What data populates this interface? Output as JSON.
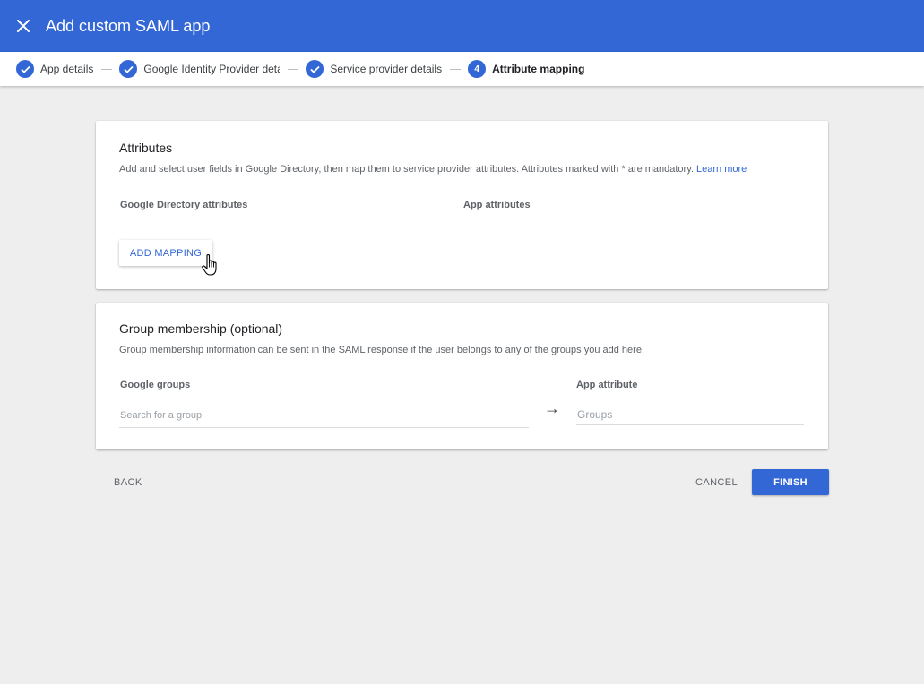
{
  "header": {
    "title": "Add custom SAML app",
    "close_icon": "close-icon"
  },
  "stepper": {
    "steps": [
      {
        "label": "App details",
        "status": "complete"
      },
      {
        "label": "Google Identity Provider details",
        "status": "complete"
      },
      {
        "label": "Service provider details",
        "status": "complete"
      },
      {
        "label": "Attribute mapping",
        "status": "active",
        "number": "4"
      }
    ]
  },
  "attributes_card": {
    "title": "Attributes",
    "description": "Add and select user fields in Google Directory, then map them to service provider attributes. Attributes marked with * are mandatory.",
    "learn_more": "Learn more",
    "col_directory": "Google Directory attributes",
    "col_app": "App attributes",
    "add_mapping": "ADD MAPPING"
  },
  "groups_card": {
    "title": "Group membership (optional)",
    "description": "Group membership information can be sent in the SAML response if the user belongs to any of the groups you add here.",
    "col_groups": "Google groups",
    "col_app_attribute": "App attribute",
    "search_placeholder": "Search for a group",
    "groups_placeholder": "Groups",
    "arrow": "→"
  },
  "footer": {
    "back": "BACK",
    "cancel": "CANCEL",
    "finish": "FINISH"
  },
  "colors": {
    "brand": "#3367d6",
    "background": "#eeeeee"
  }
}
